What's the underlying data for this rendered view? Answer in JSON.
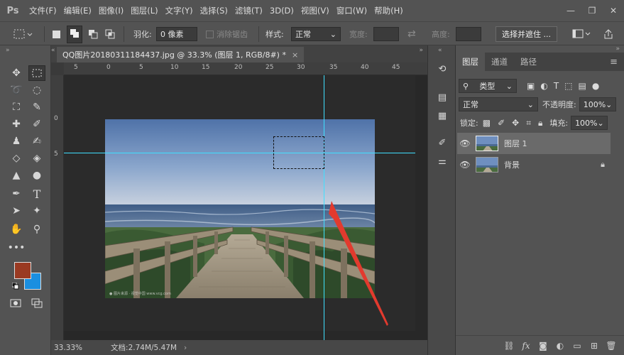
{
  "app": {
    "logo": "Ps"
  },
  "menu": [
    "文件(F)",
    "编辑(E)",
    "图像(I)",
    "图层(L)",
    "文字(Y)",
    "选择(S)",
    "滤镜(T)",
    "3D(D)",
    "视图(V)",
    "窗口(W)",
    "帮助(H)"
  ],
  "window_controls": {
    "minimize": "—",
    "restore": "❐",
    "close": "✕"
  },
  "options": {
    "feather_label": "羽化:",
    "feather_value": "0 像素",
    "antialias_label": "消除锯齿",
    "style_label": "样式:",
    "style_value": "正常",
    "width_label": "宽度:",
    "height_label": "高度:",
    "select_mask_button": "选择并遮住 ..."
  },
  "document": {
    "tab_title": "QQ图片20180311184437.jpg @ 33.3% (图层 1, RGB/8#) *",
    "tab_close": "×",
    "zoom": "33.33%",
    "doc_info": "文档:2.74M/5.47M",
    "ruler_top": [
      "5",
      "0",
      "5",
      "10",
      "15",
      "20",
      "25",
      "30",
      "35",
      "40",
      "45"
    ],
    "ruler_left": [
      "0",
      "5"
    ]
  },
  "layers_panel": {
    "tabs": [
      "图层",
      "通道",
      "路径"
    ],
    "filter_kind": "类型",
    "blend_mode": "正常",
    "opacity_label": "不透明度:",
    "opacity_value": "100%",
    "lock_label": "锁定:",
    "fill_label": "填充:",
    "fill_value": "100%",
    "layers": [
      {
        "name": "图层 1",
        "active": true,
        "locked": false
      },
      {
        "name": "背景",
        "active": false,
        "locked": true
      }
    ]
  },
  "colors": {
    "foreground": "#9a3a22",
    "background": "#1a8fe0",
    "guide": "#3fe0ff",
    "annotation_arrow": "#e23a2e"
  },
  "icons": {
    "tools": [
      "move-icon",
      "marquee-icon",
      "lasso-icon",
      "quick-select-icon",
      "crop-icon",
      "eyedropper-icon",
      "healing-brush-icon",
      "brush-icon",
      "clone-stamp-icon",
      "history-brush-icon",
      "eraser-icon",
      "paint-bucket-icon",
      "blur-icon",
      "dodge-icon",
      "pen-icon",
      "type-icon",
      "path-select-icon",
      "custom-shape-icon",
      "hand-icon",
      "zoom-icon",
      "more-tools-icon"
    ]
  }
}
